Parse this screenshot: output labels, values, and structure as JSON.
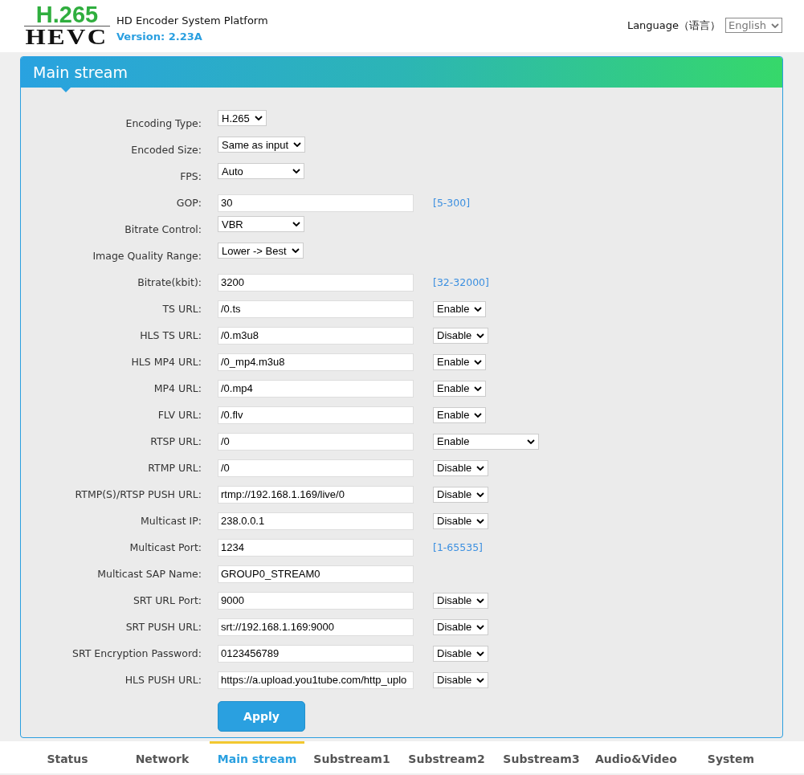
{
  "header": {
    "logo_top": "H.265",
    "logo_bottom": "HEVC",
    "title": "HD Encoder System Platform",
    "version": "Version: 2.23A",
    "language_label": "Language（语言）",
    "language_value": "English"
  },
  "panel": {
    "title": "Main stream",
    "rows": [
      {
        "label": "Encoding Type:",
        "kind": "select",
        "value": "H.265"
      },
      {
        "label": "Encoded Size:",
        "kind": "select",
        "value": "Same as input"
      },
      {
        "label": "FPS:",
        "kind": "select",
        "value": "Auto",
        "wide": true
      },
      {
        "label": "GOP:",
        "kind": "text",
        "value": "30",
        "hint": "[5-300]"
      },
      {
        "label": "Bitrate Control:",
        "kind": "select",
        "value": "VBR",
        "wide": true
      },
      {
        "label": "Image Quality Range:",
        "kind": "select",
        "value": "Lower -> Best"
      },
      {
        "label": "Bitrate(kbit):",
        "kind": "text",
        "value": "3200",
        "hint": "[32-32000]"
      },
      {
        "label": "TS URL:",
        "kind": "text",
        "value": "/0.ts",
        "option": "Enable"
      },
      {
        "label": "HLS TS URL:",
        "kind": "text",
        "value": "/0.m3u8",
        "option": "Disable"
      },
      {
        "label": "HLS MP4 URL:",
        "kind": "text",
        "value": "/0_mp4.m3u8",
        "option": "Enable"
      },
      {
        "label": "MP4 URL:",
        "kind": "text",
        "value": "/0.mp4",
        "option": "Enable"
      },
      {
        "label": "FLV URL:",
        "kind": "text",
        "value": "/0.flv",
        "option": "Enable"
      },
      {
        "label": "RTSP URL:",
        "kind": "text",
        "value": "/0",
        "option": "Enable",
        "option_wide": true
      },
      {
        "label": "RTMP URL:",
        "kind": "text",
        "value": "/0",
        "option": "Disable"
      },
      {
        "label": "RTMP(S)/RTSP PUSH URL:",
        "kind": "text",
        "value": "rtmp://192.168.1.169/live/0",
        "option": "Disable"
      },
      {
        "label": "Multicast IP:",
        "kind": "text",
        "value": "238.0.0.1",
        "option": "Disable"
      },
      {
        "label": "Multicast Port:",
        "kind": "text",
        "value": "1234",
        "hint": "[1-65535]"
      },
      {
        "label": "Multicast SAP Name:",
        "kind": "text",
        "value": "GROUP0_STREAM0"
      },
      {
        "label": "SRT URL Port:",
        "kind": "text",
        "value": "9000",
        "option": "Disable"
      },
      {
        "label": "SRT PUSH URL:",
        "kind": "text",
        "value": "srt://192.168.1.169:9000",
        "option": "Disable"
      },
      {
        "label": "SRT Encryption Password:",
        "kind": "text",
        "value": "0123456789",
        "option": "Disable"
      },
      {
        "label": "HLS PUSH URL:",
        "kind": "text",
        "value": "https://a.upload.you1tube.com/http_uplo",
        "option": "Disable"
      }
    ],
    "apply": "Apply"
  },
  "tabs": [
    {
      "label": "Status",
      "selected": false
    },
    {
      "label": "Network",
      "selected": false
    },
    {
      "label": "Main stream",
      "selected": true
    },
    {
      "label": "Substream1",
      "selected": false
    },
    {
      "label": "Substream2",
      "selected": false
    },
    {
      "label": "Substream3",
      "selected": false
    },
    {
      "label": "Audio&Video",
      "selected": false
    },
    {
      "label": "System",
      "selected": false
    }
  ]
}
